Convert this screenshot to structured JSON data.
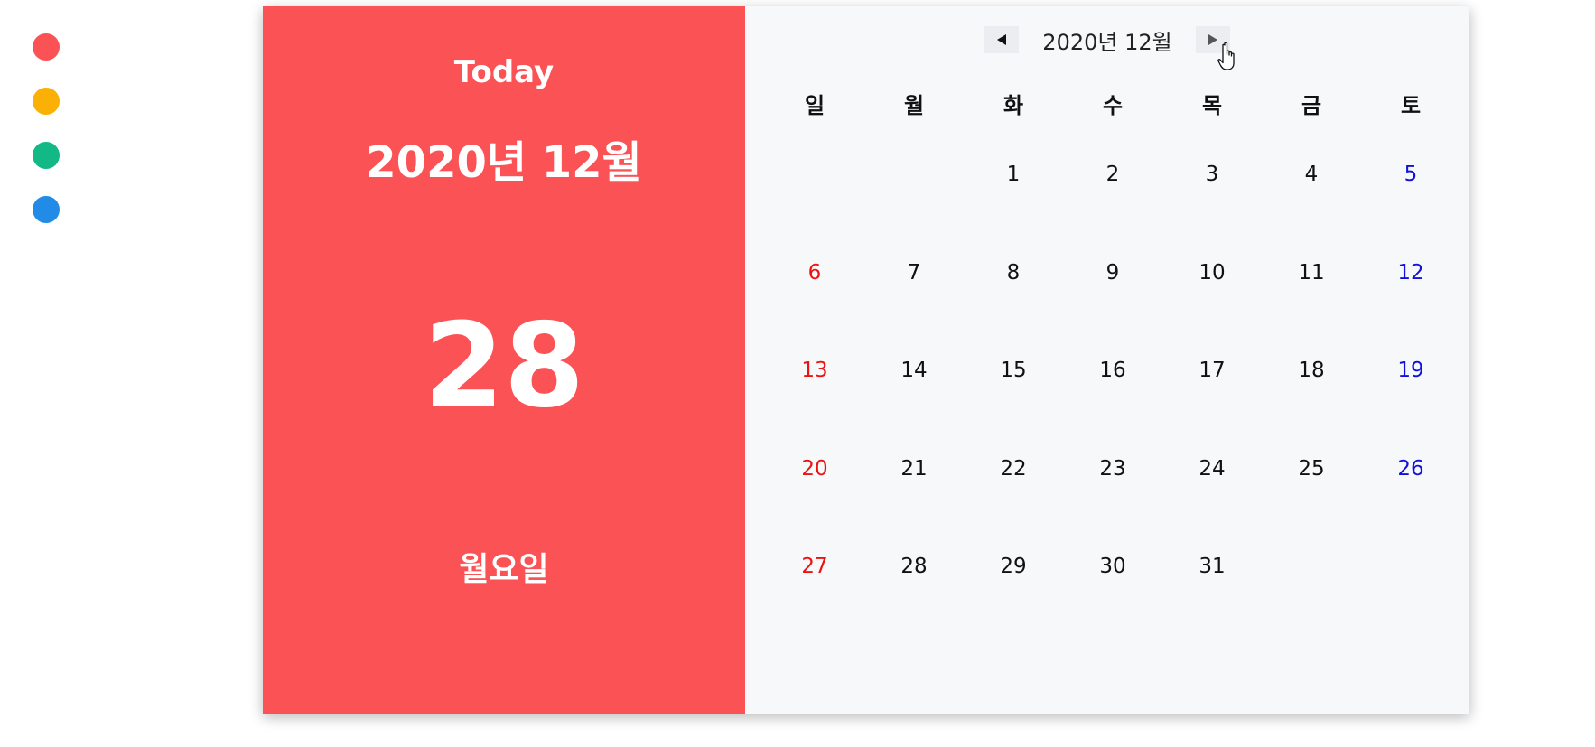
{
  "theme_colors": [
    "#fa5255",
    "#fab005",
    "#12b886",
    "#228be6"
  ],
  "today_panel": {
    "label": "Today",
    "month": "2020년 12월",
    "day": "28",
    "weekday": "월요일",
    "background": "#fa5255"
  },
  "calendar": {
    "title": "2020년 12월",
    "prev_icon": "left-triangle-icon",
    "next_icon": "right-triangle-icon",
    "weekdays": [
      "일",
      "월",
      "화",
      "수",
      "목",
      "금",
      "토"
    ],
    "weeks": [
      [
        "",
        "",
        "1",
        "2",
        "3",
        "4",
        "5"
      ],
      [
        "6",
        "7",
        "8",
        "9",
        "10",
        "11",
        "12"
      ],
      [
        "13",
        "14",
        "15",
        "16",
        "17",
        "18",
        "19"
      ],
      [
        "20",
        "21",
        "22",
        "23",
        "24",
        "25",
        "26"
      ],
      [
        "27",
        "28",
        "29",
        "30",
        "31",
        "",
        ""
      ]
    ],
    "colors": {
      "sunday": "#ee1111",
      "saturday": "#1111dd",
      "weekday": "#111111"
    }
  }
}
